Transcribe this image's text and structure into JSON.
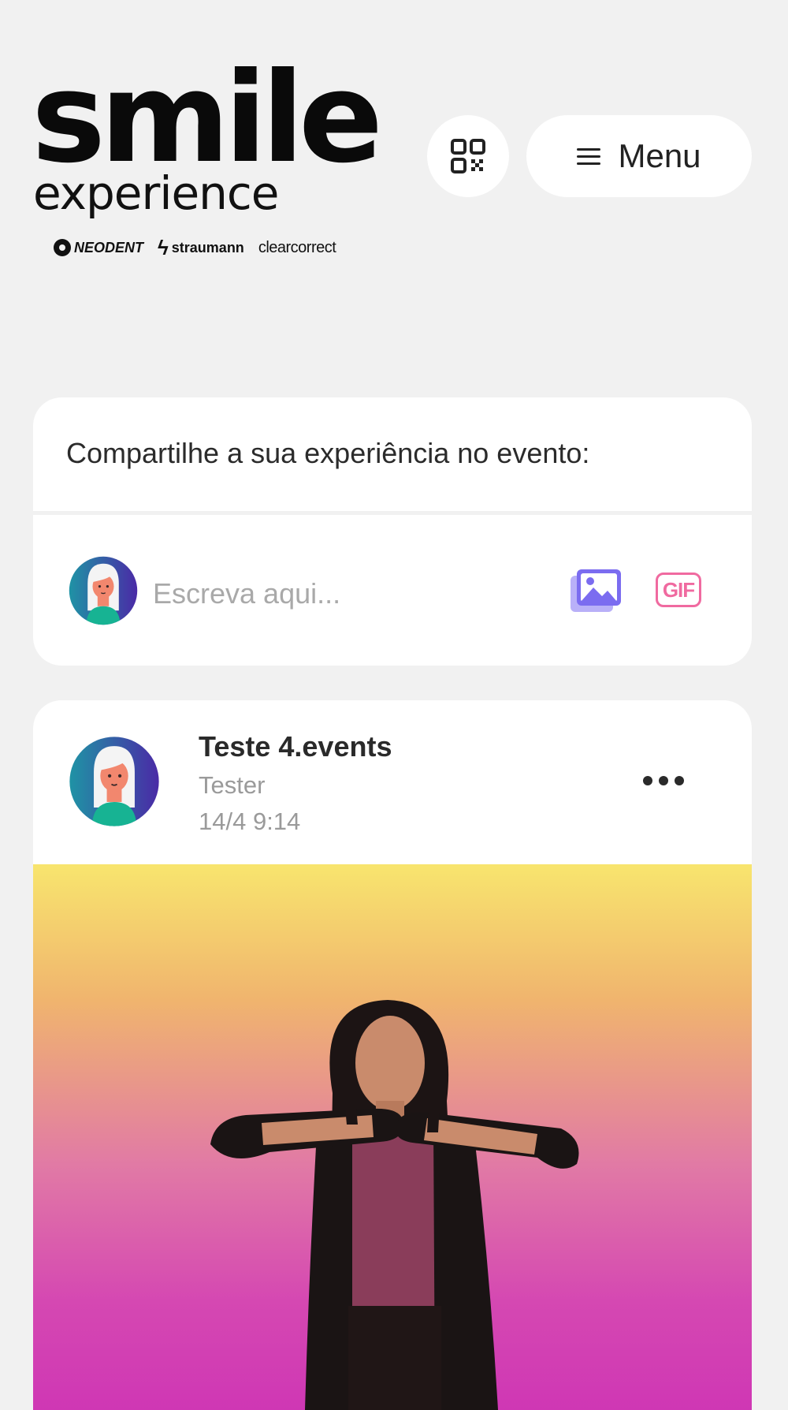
{
  "header": {
    "logo": {
      "main": "smile",
      "sub": "experience",
      "brands": [
        "NEODENT",
        "straumann",
        "clearcorrect"
      ]
    },
    "qr_icon": "qr-code-icon",
    "menu_icon": "hamburger-icon",
    "menu_label": "Menu"
  },
  "composer": {
    "title": "Compartilhe a sua experiência no evento:",
    "input_placeholder": "Escreva aqui...",
    "image_icon": "image-icon",
    "gif_label": "GIF",
    "colors": {
      "image_icon": "#7b6cf0",
      "gif": "#f06aa0"
    }
  },
  "post": {
    "author": "Teste 4.events",
    "role": "Tester",
    "timestamp": "14/4 9:14",
    "more_icon": "more-dots-icon",
    "media_gradient": [
      "#f8e56e",
      "#cf37b4"
    ]
  },
  "colors": {
    "background": "#f1f1f1",
    "card": "#ffffff",
    "avatar_gradient": [
      "#1f93a5",
      "#4a2aa6"
    ]
  }
}
